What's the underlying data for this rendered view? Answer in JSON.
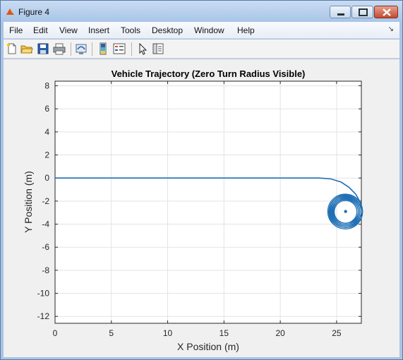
{
  "window": {
    "title": "Figure 4",
    "colors": {
      "titlebar": "#aac3e2",
      "close": "#c24a32",
      "trace": "#1f6fb5"
    }
  },
  "menu": {
    "items": [
      "File",
      "Edit",
      "View",
      "Insert",
      "Tools",
      "Desktop",
      "Window",
      "Help"
    ]
  },
  "toolbar": {
    "icons": [
      "new-figure-icon",
      "open-file-icon",
      "save-icon",
      "print-icon",
      "link-plot-icon",
      "colorbar-icon",
      "legend-icon",
      "pointer-icon",
      "property-editor-icon"
    ]
  },
  "chart_data": {
    "type": "line",
    "title": "Vehicle Trajectory (Zero Turn Radius Visible)",
    "xlabel": "X Position (m)",
    "ylabel": "Y Position (m)",
    "xlim": [
      0,
      27.2
    ],
    "ylim": [
      -12.6,
      8.4
    ],
    "xticks": [
      0,
      5,
      10,
      15,
      20,
      25
    ],
    "yticks": [
      8,
      6,
      4,
      2,
      0,
      -2,
      -4,
      -6,
      -8,
      -10,
      -12
    ],
    "grid": true,
    "series": [
      {
        "straight_segment": {
          "x": [
            0,
            23.5
          ],
          "y": [
            0,
            0
          ]
        },
        "turn_entry": {
          "x": [
            23.5,
            24.5,
            25.4,
            26.1,
            26.7,
            27.1,
            27.2
          ],
          "y": [
            0,
            -0.08,
            -0.35,
            -0.8,
            -1.4,
            -2.1,
            -2.8
          ]
        },
        "circle_center": [
          25.8,
          -2.9
        ],
        "circle_radius_outer": 1.55,
        "circle_radius_inner": 1.0,
        "end_point": [
          25.8,
          -2.9
        ]
      }
    ]
  }
}
